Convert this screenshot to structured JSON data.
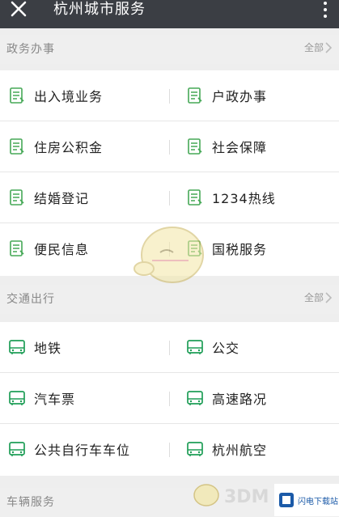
{
  "header": {
    "title": "杭州城市服务"
  },
  "sections": [
    {
      "title": "政务办事",
      "all_label": "全部",
      "rows": [
        [
          {
            "label": "出入境业务"
          },
          {
            "label": "户政办事"
          }
        ],
        [
          {
            "label": "住房公积金"
          },
          {
            "label": "社会保障"
          }
        ],
        [
          {
            "label": "结婚登记"
          },
          {
            "label": "1234热线"
          }
        ],
        [
          {
            "label": "便民信息"
          },
          {
            "label": "国税服务"
          }
        ]
      ]
    },
    {
      "title": "交通出行",
      "all_label": "全部",
      "rows": [
        [
          {
            "label": "地铁"
          },
          {
            "label": "公交"
          }
        ],
        [
          {
            "label": "汽车票"
          },
          {
            "label": "高速路况"
          }
        ],
        [
          {
            "label": "公共自行车车位"
          },
          {
            "label": "杭州航空"
          }
        ]
      ]
    },
    {
      "title": "车辆服务"
    }
  ],
  "watermark": {
    "text": "3DM",
    "site": "闪电下载站"
  },
  "colors": {
    "topbar": "#3b3e44",
    "gov_icon": "#46a857",
    "traffic_icon": "#1f9e57"
  },
  "icons": {
    "gov": "document-list-icon",
    "traffic": "bus-icon",
    "close": "close-icon",
    "more": "more-vertical-icon",
    "arrow": "chevron-right-icon"
  }
}
